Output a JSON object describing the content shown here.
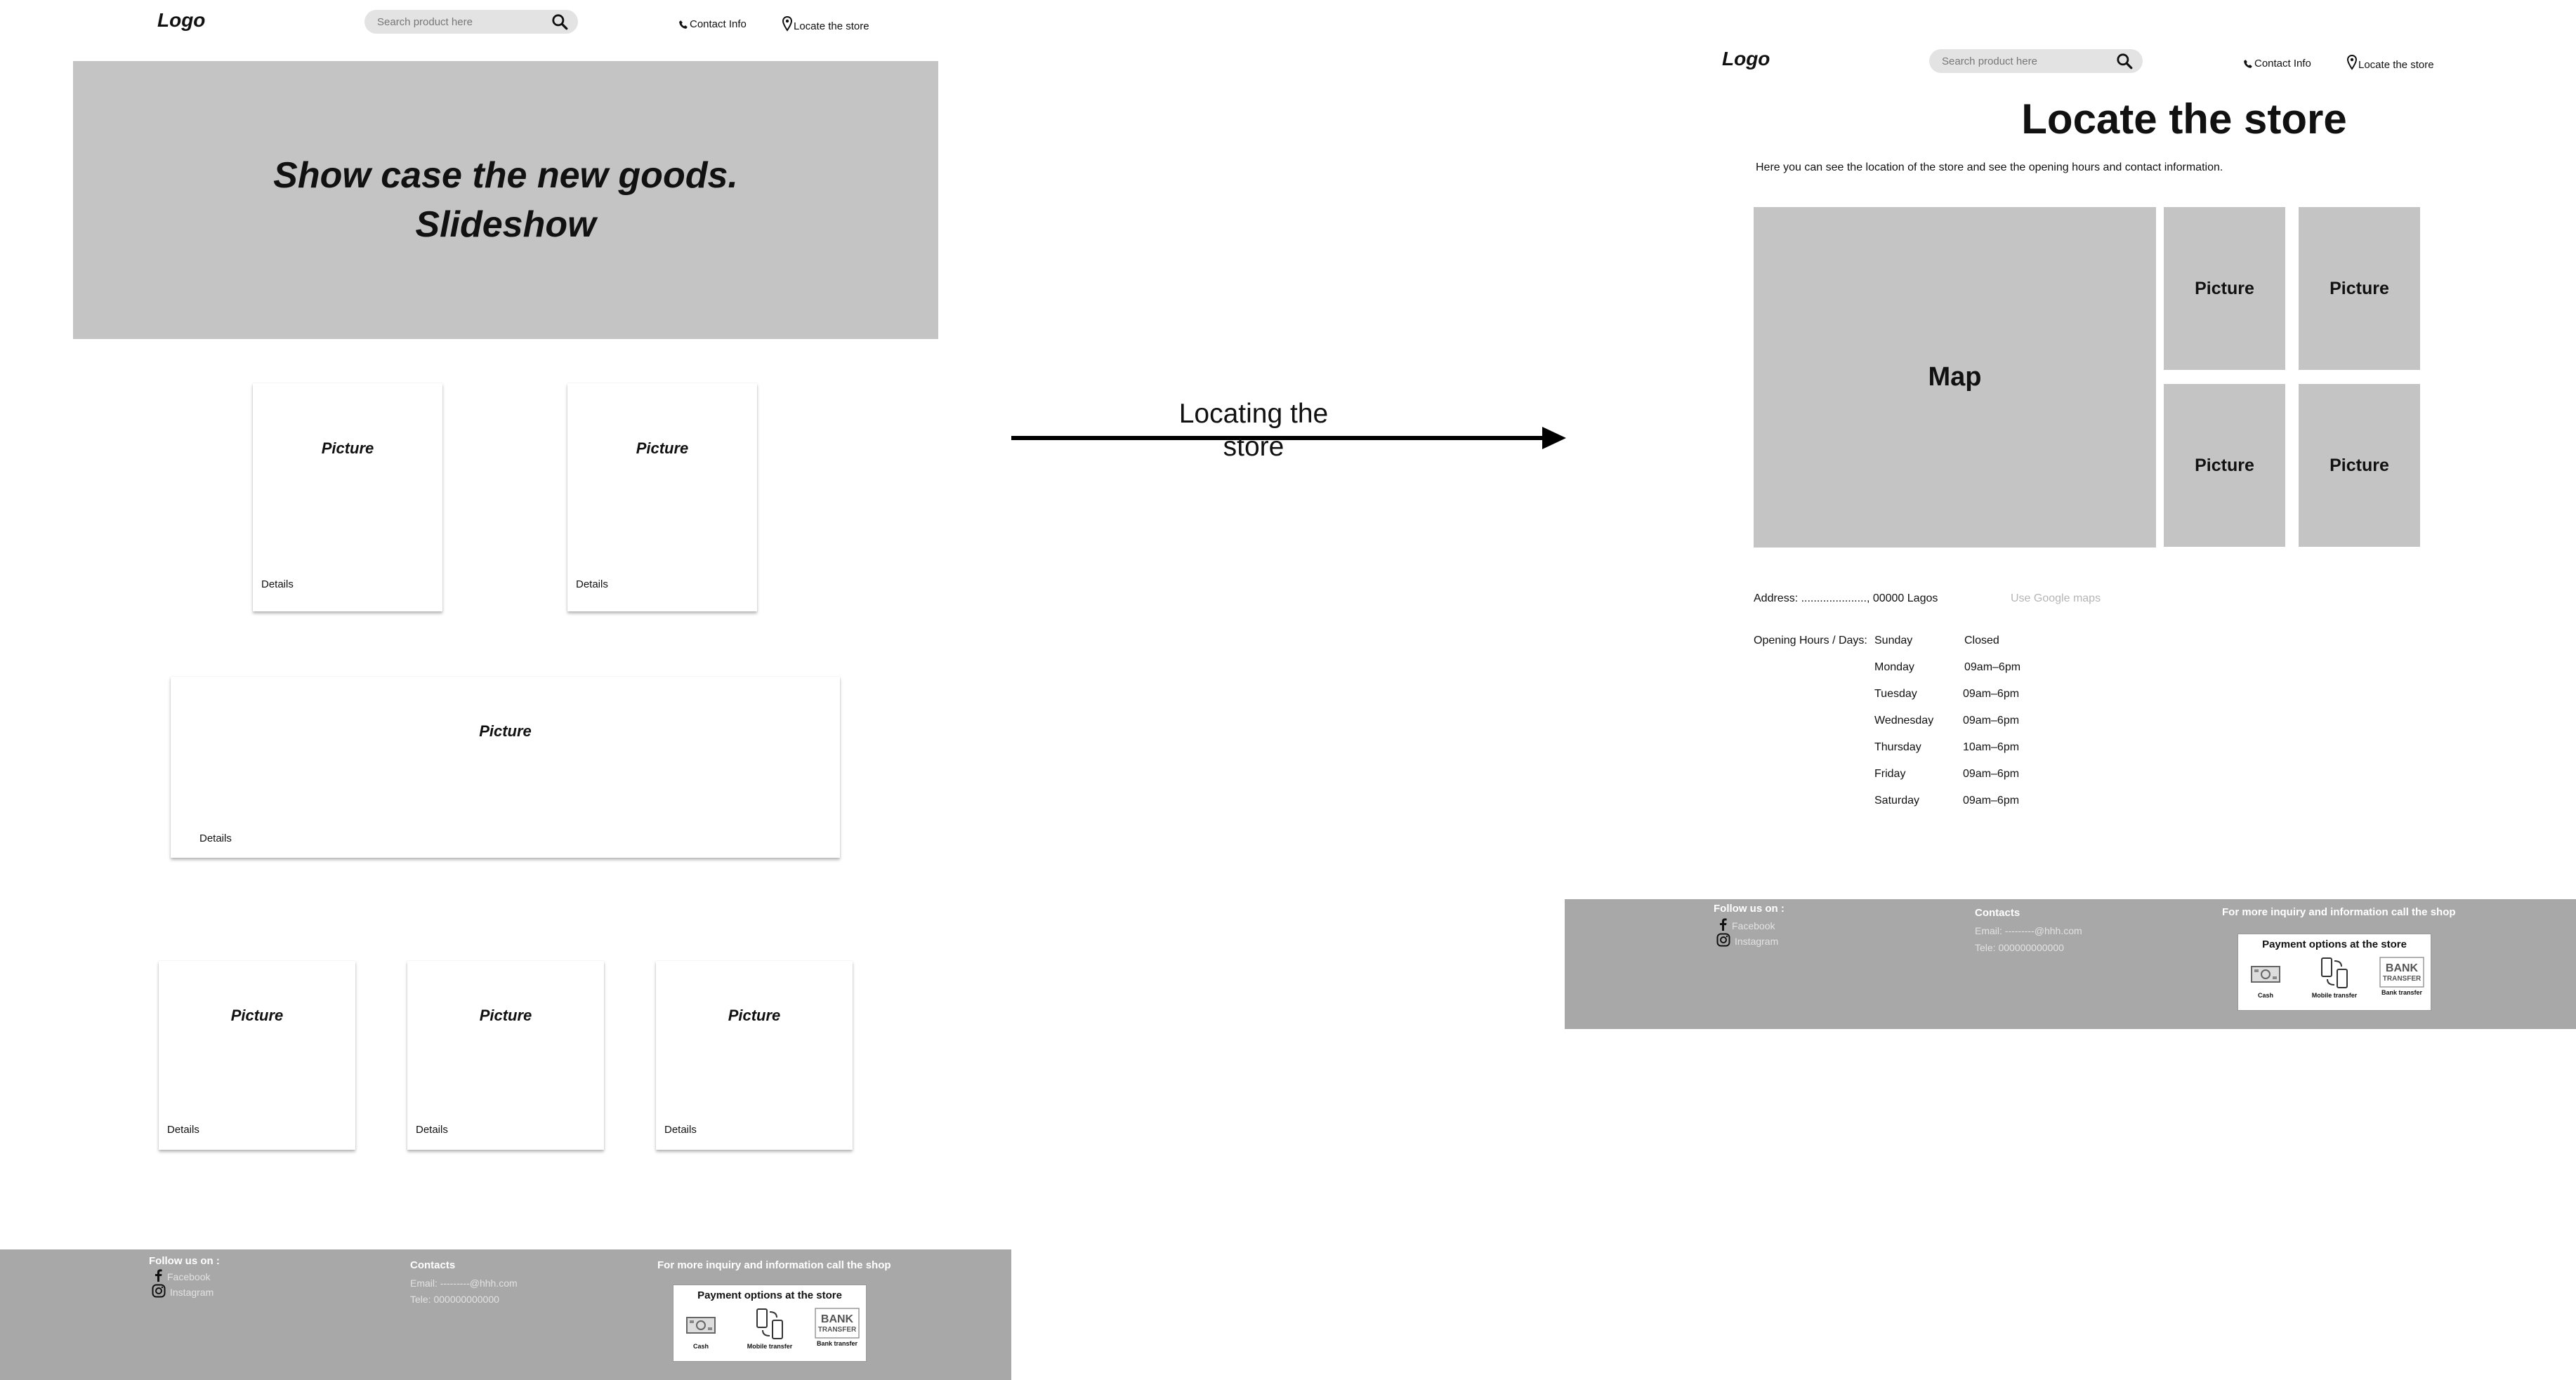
{
  "left_page": {
    "header": {
      "logo": "Logo",
      "search_placeholder": "Search product here",
      "contact_label": "Contact Info",
      "locate_label": "Locate the store"
    },
    "hero": {
      "line1": "Show case the new goods.",
      "line2": "Slideshow"
    },
    "cards_top": [
      {
        "picture": "Picture",
        "details": "Details"
      },
      {
        "picture": "Picture",
        "details": "Details"
      }
    ],
    "card_wide": {
      "picture": "Picture",
      "details": "Details"
    },
    "cards_bottom": [
      {
        "picture": "Picture",
        "details": "Details"
      },
      {
        "picture": "Picture",
        "details": "Details"
      },
      {
        "picture": "Picture",
        "details": "Details"
      }
    ],
    "footer": {
      "follow_title": "Follow us on :",
      "facebook": "Facebook",
      "instagram": "Instagram",
      "contacts_title": "Contacts",
      "email": "Email: ---------@hhh.com",
      "tele": "Tele: 000000000000",
      "inquiry": "For more inquiry and information call the shop",
      "payment_title": "Payment options at the store",
      "cash": "Cash",
      "mobile": "Mobile transfer",
      "bank": "Bank transfer",
      "bank_logo_line1": "BANK",
      "bank_logo_line2": "TRANSFER"
    }
  },
  "arrow": {
    "label_line1": "Locating the",
    "label_line2": "store"
  },
  "right_page": {
    "header": {
      "logo": "Logo",
      "search_placeholder": "Search product here",
      "contact_label": "Contact Info",
      "locate_label": "Locate the store"
    },
    "title": "Locate the store",
    "intro": "Here you can see the location of the store and see the opening hours and contact information.",
    "map_label": "Map",
    "pictures": [
      "Picture",
      "Picture",
      "Picture",
      "Picture"
    ],
    "address": "Address: ....................., 00000 Lagos",
    "google_maps": "Use Google maps",
    "hours_label": "Opening Hours / Days:",
    "hours": [
      {
        "day": "Sunday",
        "time": "Closed"
      },
      {
        "day": "Monday",
        "time": "09am–6pm"
      },
      {
        "day": "Tuesday",
        "time": "09am–6pm"
      },
      {
        "day": "Wednesday",
        "time": "09am–6pm"
      },
      {
        "day": "Thursday",
        "time": "10am–6pm"
      },
      {
        "day": "Friday",
        "time": "09am–6pm"
      },
      {
        "day": "Saturday",
        "time": "09am–6pm"
      }
    ],
    "footer": {
      "follow_title": "Follow us on :",
      "facebook": "Facebook",
      "instagram": "Instagram",
      "contacts_title": "Contacts",
      "email": "Email: ---------@hhh.com",
      "tele": "Tele: 000000000000",
      "inquiry": "For more inquiry and information call the shop",
      "payment_title": "Payment options at the store",
      "cash": "Cash",
      "mobile": "Mobile transfer",
      "bank": "Bank transfer",
      "bank_logo_line1": "BANK",
      "bank_logo_line2": "TRANSFER"
    }
  },
  "colors": {
    "placeholder_gray": "#c4c4c4",
    "footer_gray": "#a8a8a8",
    "search_bg": "#e3e3e3",
    "muted_text": "#e2e2e2",
    "link_muted": "#b5b5b5"
  },
  "icons": [
    "search-icon",
    "phone-icon",
    "location-pin-icon",
    "facebook-icon",
    "instagram-icon",
    "cash-icon",
    "mobile-transfer-icon",
    "bank-transfer-icon",
    "arrow-right-icon"
  ]
}
